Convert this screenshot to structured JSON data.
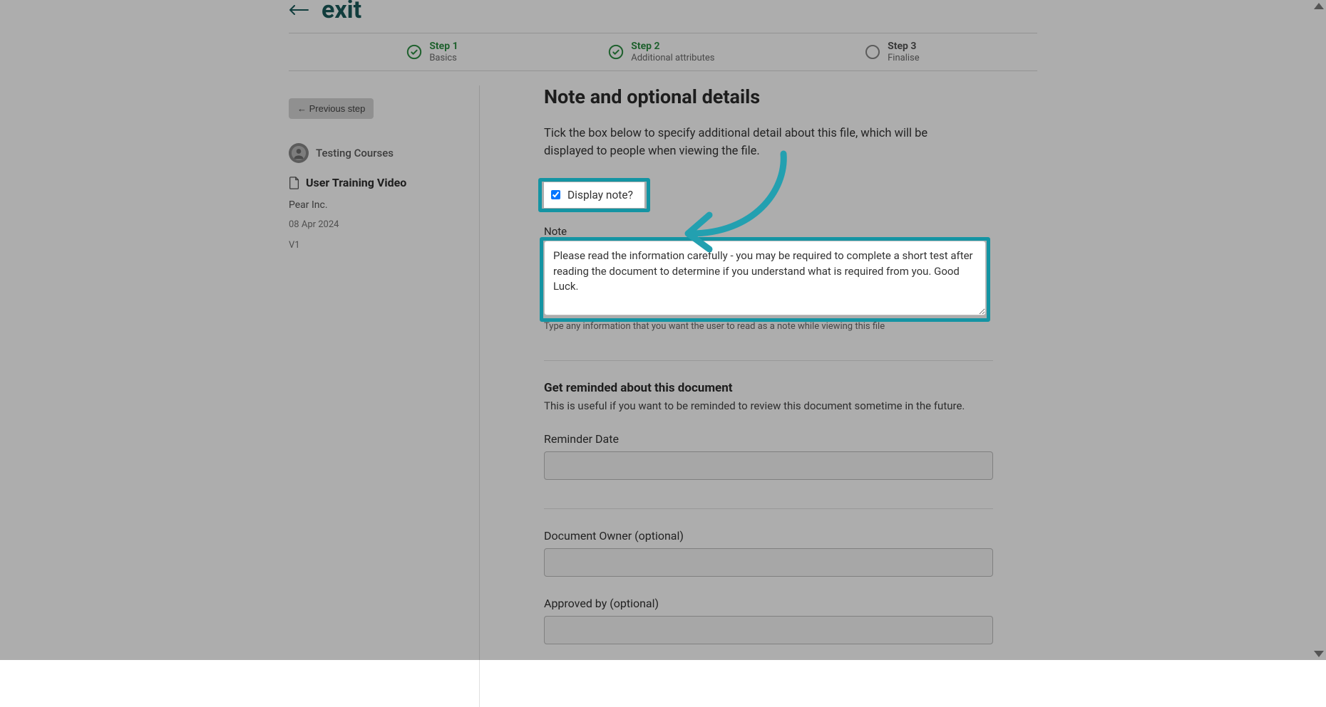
{
  "exit": {
    "label": "exit"
  },
  "stepper": {
    "step1": {
      "title": "Step 1",
      "sub": "Basics"
    },
    "step2": {
      "title": "Step 2",
      "sub": "Additional attributes"
    },
    "step3": {
      "title": "Step 3",
      "sub": "Finalise"
    }
  },
  "sidebar": {
    "prev_btn": "← Previous step",
    "author": "Testing Courses",
    "doc_title": "User Training Video",
    "org": "Pear Inc.",
    "date": "08 Apr 2024",
    "version": "V1"
  },
  "note_section": {
    "heading": "Note and optional details",
    "desc": "Tick the box below to specify additional detail about this file, which will be displayed to people when viewing the file.",
    "display_note_label": "Display note?",
    "display_note_checked": true,
    "note_label": "Note",
    "note_value": "Please read the information carefully - you may be required to complete a short test after reading the document to determine if you understand what is required from you. Good Luck.",
    "note_helper": "Type any information that you want the user to read as a note while viewing this file"
  },
  "reminder_section": {
    "heading": "Get reminded about this document",
    "desc": "This is useful if you want to be reminded to review this document sometime in the future.",
    "reminder_label": "Reminder Date",
    "reminder_value": ""
  },
  "owner_section": {
    "owner_label": "Document Owner (optional)",
    "owner_value": "",
    "approved_label": "Approved by (optional)",
    "approved_value": ""
  }
}
